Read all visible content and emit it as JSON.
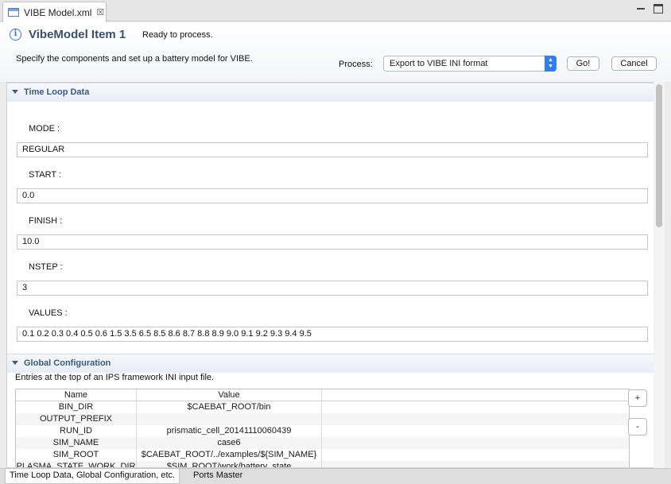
{
  "editor": {
    "tab_label": "VIBE Model.xml"
  },
  "header": {
    "title": "VibeModel Item 1",
    "status": "Ready to process.",
    "description": "Specify the components and set up a battery model for VIBE.",
    "process_label": "Process:",
    "process_value": "Export to VIBE INI format",
    "go_label": "Go!",
    "cancel_label": "Cancel"
  },
  "time_loop": {
    "title": "Time Loop Data",
    "fields": [
      {
        "label": "MODE :",
        "value": "REGULAR"
      },
      {
        "label": "START :",
        "value": "0.0"
      },
      {
        "label": "FINISH :",
        "value": "10.0"
      },
      {
        "label": "NSTEP :",
        "value": "3"
      },
      {
        "label": "VALUES :",
        "value": "0.1 0.2 0.3 0.4 0.5 0.6 1.5 3.5 6.5 8.5 8.6 8.7 8.8 8.9 9.0 9.1 9.2 9.3 9.4 9.5"
      }
    ]
  },
  "global_config": {
    "title": "Global Configuration",
    "description": "Entries at the top of an IPS framework INI input file.",
    "columns": [
      "Name",
      "Value"
    ],
    "rows": [
      {
        "name": "BIN_DIR",
        "value": "$CAEBAT_ROOT/bin"
      },
      {
        "name": "OUTPUT_PREFIX",
        "value": ""
      },
      {
        "name": "RUN_ID",
        "value": "prismatic_cell_20141110060439"
      },
      {
        "name": "SIM_NAME",
        "value": "case6"
      },
      {
        "name": "SIM_ROOT",
        "value": "$CAEBAT_ROOT/../examples/${SIM_NAME}"
      },
      {
        "name": "PLASMA_STATE_WORK_DIR",
        "value": "$SIM_ROOT/work/battery_state"
      }
    ],
    "add_label": "+",
    "remove_label": "-"
  },
  "bottom_tabs": [
    {
      "label": "Time Loop Data, Global Configuration, etc."
    },
    {
      "label": "Ports Master"
    }
  ],
  "colors": {
    "accent": "#2f7ff2",
    "section_title": "#3b587f",
    "form_title": "#3a4f6e"
  }
}
